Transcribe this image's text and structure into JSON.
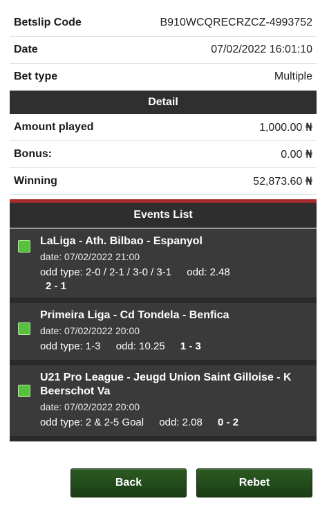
{
  "info": {
    "betslip_label": "Betslip Code",
    "betslip_value": "B910WCQRECRZCZ-4993752",
    "date_label": "Date",
    "date_value": "07/02/2022 16:01:10",
    "bettype_label": "Bet type",
    "bettype_value": "Multiple"
  },
  "detail": {
    "header": "Detail",
    "amount_label": "Amount played",
    "amount_value": "1,000.00",
    "bonus_label": "Bonus:",
    "bonus_value": "0.00",
    "winning_label": "Winning",
    "winning_value": "52,873.60",
    "currency_symbol": "₦"
  },
  "events": {
    "header": "Events List",
    "items": [
      {
        "title": "LaLiga - Ath. Bilbao - Espanyol",
        "date": "date: 07/02/2022 21:00",
        "oddtype": "odd type: 2-0 / 2-1 / 3-0 / 3-1",
        "odd": "odd: 2.48",
        "score": "2 - 1"
      },
      {
        "title": "Primeira Liga - Cd Tondela - Benfica",
        "date": "date: 07/02/2022 20:00",
        "oddtype": "odd type: 1-3",
        "odd": "odd: 10.25",
        "score": "1 - 3"
      },
      {
        "title": "U21 Pro League - Jeugd Union Saint Gilloise - K Beerschot Va",
        "date": "date: 07/02/2022 20:00",
        "oddtype": "odd type: 2 & 2-5 Goal",
        "odd": "odd: 2.08",
        "score": "0 - 2"
      }
    ]
  },
  "footer": {
    "back_label": "Back",
    "rebet_label": "Rebet"
  },
  "colors": {
    "header_bar": "#2f2f2f",
    "accent_red": "#a72a2a",
    "button_green": "#2c5a22",
    "check_green": "#57c13b"
  }
}
